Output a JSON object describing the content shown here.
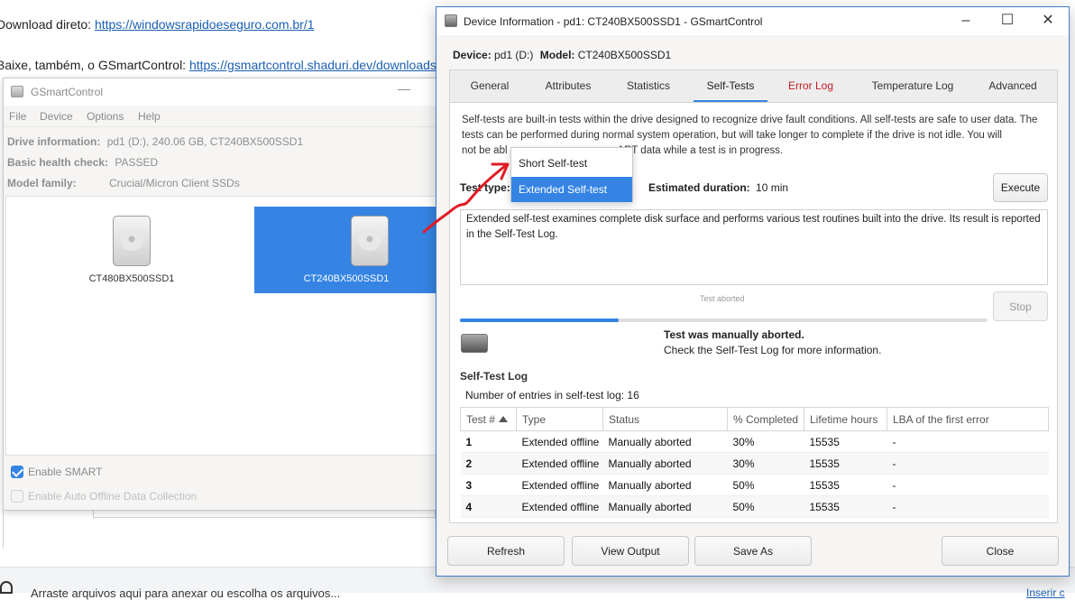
{
  "webpage": {
    "line1_prefix": "Download direto: ",
    "line1_link": "https://windowsrapidoeseguro.com.br/1",
    "line2_prefix": "Baixe, também, o GSmartControl: ",
    "line2_link": "https://gsmartcontrol.shaduri.dev/downloads",
    "bottom_text": "Arraste arquivos aqui para anexar ou escolha os arquivos...",
    "bottom_right": "Inserir c"
  },
  "main_window": {
    "title": "GSmartControl",
    "minimize": "—",
    "menu": [
      "File",
      "Device",
      "Options",
      "Help"
    ],
    "drive_info_label": "Drive information:",
    "drive_info_value": "pd1 (D:), 240.06 GB, CT240BX500SSD1",
    "health_label": "Basic health check:",
    "health_value": "PASSED",
    "family_label": "Model family:",
    "family_value": "Crucial/Micron Client SSDs",
    "drives": [
      "CT480BX500SSD1",
      "CT240BX500SSD1"
    ],
    "enable_smart": "Enable SMART",
    "enable_auto_offline": "Enable Auto Offline Data Collection"
  },
  "dialog": {
    "title": "Device Information - pd1: CT240BX500SSD1 - GSmartControl",
    "device_label": "Device:",
    "device_value": "pd1 (D:)",
    "model_label": "Model:",
    "model_value": "CT240BX500SSD1",
    "tabs": [
      "General",
      "Attributes",
      "Statistics",
      "Self-Tests",
      "Error Log",
      "Temperature Log",
      "Advanced"
    ],
    "active_tab": "Self-Tests",
    "description_1": "Self-tests are built-in tests within the drive designed to recognize drive fault conditions. All self-tests are safe to user data. The tests can be performed during normal system operation, but will take longer to complete if the drive is not idle. You will",
    "description_2a": "not be abl",
    "description_2b": "ART data while a test is in progress.",
    "test_type_label": "Test type:",
    "estimated_label": "Estimated duration:",
    "estimated_value": "10 min",
    "execute_button": "Execute",
    "test_description": "Extended self-test examines complete disk surface and performs various test routines built into the drive. Its result is reported in the Self-Test Log.",
    "status_small": "Test aborted",
    "stop_button": "Stop",
    "progress_fraction": 0.3,
    "result_title": "Test was manually aborted.",
    "result_detail": "Check the Self-Test Log for more information.",
    "log_title": "Self-Test Log",
    "log_count": "Number of entries in self-test log: 16",
    "log_columns": [
      "Test #",
      "Type",
      "Status",
      "% Completed",
      "Lifetime hours",
      "LBA of the first error"
    ],
    "log_rows": [
      [
        "1",
        "Extended offline",
        "Manually aborted",
        "30%",
        "15535",
        "-"
      ],
      [
        "2",
        "Extended offline",
        "Manually aborted",
        "30%",
        "15535",
        "-"
      ],
      [
        "3",
        "Extended offline",
        "Manually aborted",
        "50%",
        "15535",
        "-"
      ],
      [
        "4",
        "Extended offline",
        "Manually aborted",
        "50%",
        "15535",
        "-"
      ]
    ],
    "buttons": {
      "refresh": "Refresh",
      "view_output": "View Output",
      "save_as": "Save As",
      "close": "Close"
    },
    "dropdown_options": [
      "Short Self-test",
      "Extended Self-test"
    ],
    "dropdown_selected": "Extended Self-test"
  },
  "colors": {
    "accent": "#3584e4",
    "error_tab": "#c01c28",
    "annotation_arrow": "#e01b24"
  }
}
